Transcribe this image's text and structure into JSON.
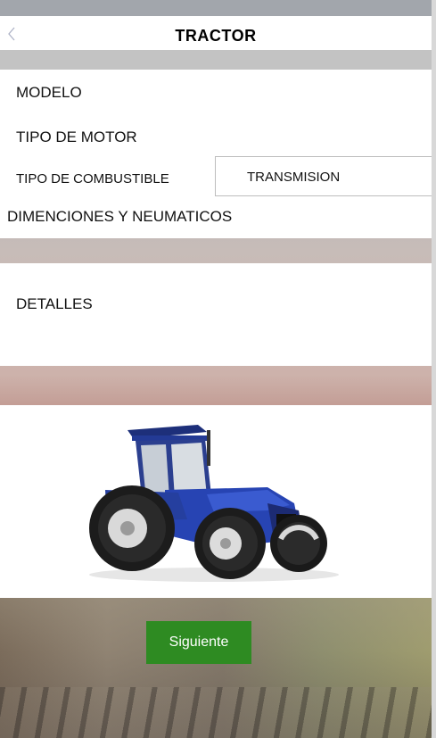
{
  "header": {
    "back_icon": "chevron-left-icon",
    "title": "TRACTOR"
  },
  "menu": {
    "modelo": "MODELO",
    "tipo_motor": "TIPO DE MOTOR",
    "tipo_combustible": "TIPO DE COMBUSTIBLE",
    "transmision": "TRANSMISION",
    "dimensiones": "DIMENCIONES Y NEUMATICOS",
    "detalles": "DETALLES"
  },
  "image": {
    "subject": "blue-tractor-image"
  },
  "actions": {
    "next_label": "Siguiente"
  },
  "colors": {
    "accent": "#2e8b22",
    "tractor_blue": "#1f3a9c",
    "back_icon": "#aeb3c7"
  }
}
